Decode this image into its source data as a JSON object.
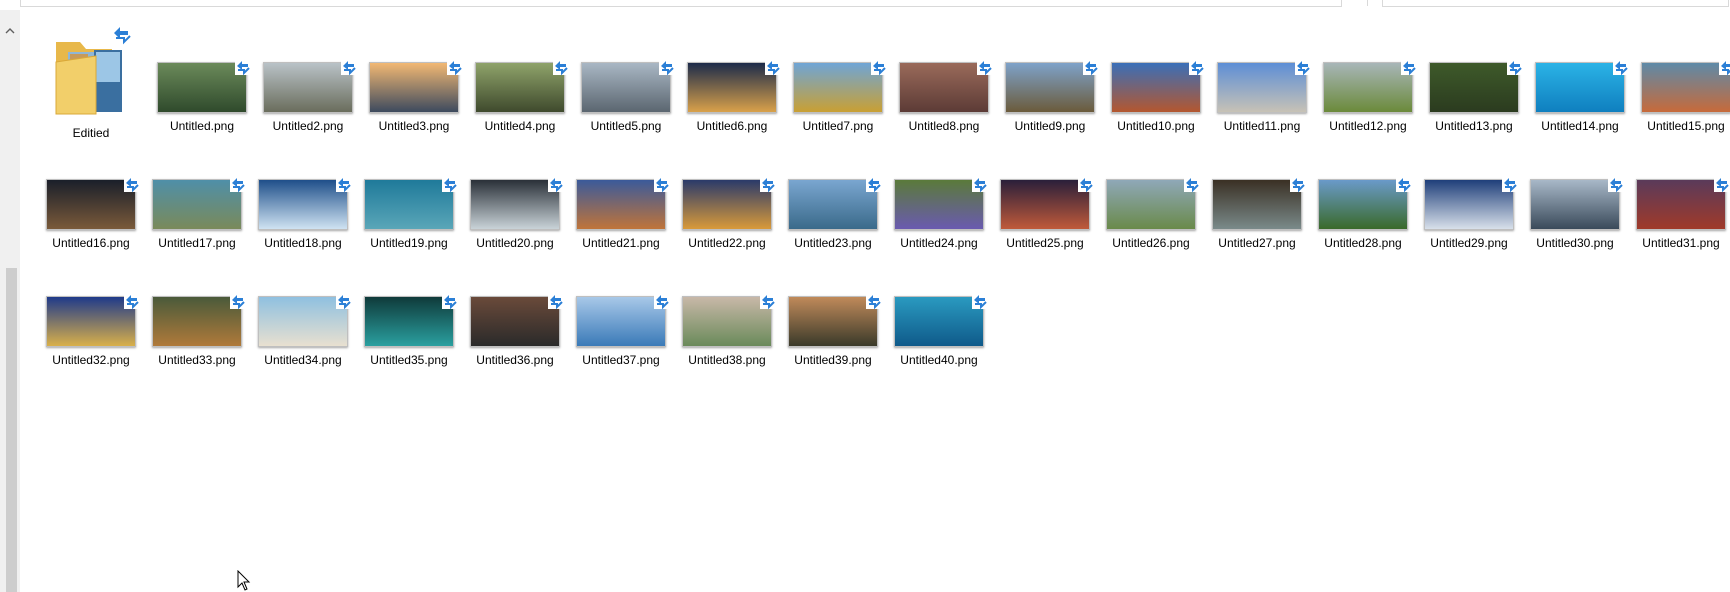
{
  "folder": {
    "label": "Editied"
  },
  "files": [
    {
      "name": "Untitled.png",
      "c1": "#6b8a5a",
      "c2": "#2f4a2c"
    },
    {
      "name": "Untitled2.png",
      "c1": "#b9c2c7",
      "c2": "#6a6d5c"
    },
    {
      "name": "Untitled3.png",
      "c1": "#f2b873",
      "c2": "#3d4a5e"
    },
    {
      "name": "Untitled4.png",
      "c1": "#8fa36a",
      "c2": "#3f4a2d"
    },
    {
      "name": "Untitled5.png",
      "c1": "#a9b7c4",
      "c2": "#5b6670"
    },
    {
      "name": "Untitled6.png",
      "c1": "#1c2b4a",
      "c2": "#d9a14a"
    },
    {
      "name": "Untitled7.png",
      "c1": "#6fa5d6",
      "c2": "#c9a033"
    },
    {
      "name": "Untitled8.png",
      "c1": "#9a6a5a",
      "c2": "#5c3b36"
    },
    {
      "name": "Untitled9.png",
      "c1": "#7ea2c9",
      "c2": "#6b5b3b"
    },
    {
      "name": "Untitled10.png",
      "c1": "#3a6fb8",
      "c2": "#b4572f"
    },
    {
      "name": "Untitled11.png",
      "c1": "#5d8ed6",
      "c2": "#c7c2b6"
    },
    {
      "name": "Untitled12.png",
      "c1": "#a8b6b8",
      "c2": "#6b8a3a"
    },
    {
      "name": "Untitled13.png",
      "c1": "#3e5a2a",
      "c2": "#2b3b1f"
    },
    {
      "name": "Untitled14.png",
      "c1": "#2bb3e6",
      "c2": "#0f7fbf"
    },
    {
      "name": "Untitled15.png",
      "c1": "#5e8aa8",
      "c2": "#c76a3a"
    },
    {
      "name": "Untitled16.png",
      "c1": "#1a1f2a",
      "c2": "#7a5a3a"
    },
    {
      "name": "Untitled17.png",
      "c1": "#4f8fa8",
      "c2": "#7a8a5a"
    },
    {
      "name": "Untitled18.png",
      "c1": "#1f4f8a",
      "c2": "#cfe3f2"
    },
    {
      "name": "Untitled19.png",
      "c1": "#1f7a9a",
      "c2": "#5aa6b8"
    },
    {
      "name": "Untitled20.png",
      "c1": "#2a3038",
      "c2": "#c9d3d8"
    },
    {
      "name": "Untitled21.png",
      "c1": "#3b5a9a",
      "c2": "#c0743a"
    },
    {
      "name": "Untitled22.png",
      "c1": "#2a3a6a",
      "c2": "#d99a3a"
    },
    {
      "name": "Untitled23.png",
      "c1": "#7aa6d0",
      "c2": "#3a6a8a"
    },
    {
      "name": "Untitled24.png",
      "c1": "#5a7a3a",
      "c2": "#6a5ab0"
    },
    {
      "name": "Untitled25.png",
      "c1": "#2a1f3a",
      "c2": "#c05a3a"
    },
    {
      "name": "Untitled26.png",
      "c1": "#8fa8b8",
      "c2": "#6a8a4a"
    },
    {
      "name": "Untitled27.png",
      "c1": "#3a3024",
      "c2": "#7a8a8a"
    },
    {
      "name": "Untitled28.png",
      "c1": "#6a9ac9",
      "c2": "#3a6a2a"
    },
    {
      "name": "Untitled29.png",
      "c1": "#1f3f7a",
      "c2": "#d8e0ea"
    },
    {
      "name": "Untitled30.png",
      "c1": "#a8b8c8",
      "c2": "#3a4a5a"
    },
    {
      "name": "Untitled31.png",
      "c1": "#5a3a5a",
      "c2": "#a03a2a"
    },
    {
      "name": "Untitled32.png",
      "c1": "#1f3a8a",
      "c2": "#d9b04a"
    },
    {
      "name": "Untitled33.png",
      "c1": "#4a5a3a",
      "c2": "#b07a3a"
    },
    {
      "name": "Untitled34.png",
      "c1": "#8fc0e0",
      "c2": "#e8e0d0"
    },
    {
      "name": "Untitled35.png",
      "c1": "#0f3a3a",
      "c2": "#2aa0a0"
    },
    {
      "name": "Untitled36.png",
      "c1": "#6a4a3a",
      "c2": "#2a2a2a"
    },
    {
      "name": "Untitled37.png",
      "c1": "#a8c8e8",
      "c2": "#3a7ab8"
    },
    {
      "name": "Untitled38.png",
      "c1": "#c8b8a8",
      "c2": "#6a8a5a"
    },
    {
      "name": "Untitled39.png",
      "c1": "#c08a5a",
      "c2": "#3a3a2a"
    },
    {
      "name": "Untitled40.png",
      "c1": "#2a9ac0",
      "c2": "#0f5a8a"
    }
  ],
  "colors": {
    "sync_badge": "#2b7fd6",
    "scrollbar_thumb": "#cdcdcd"
  }
}
